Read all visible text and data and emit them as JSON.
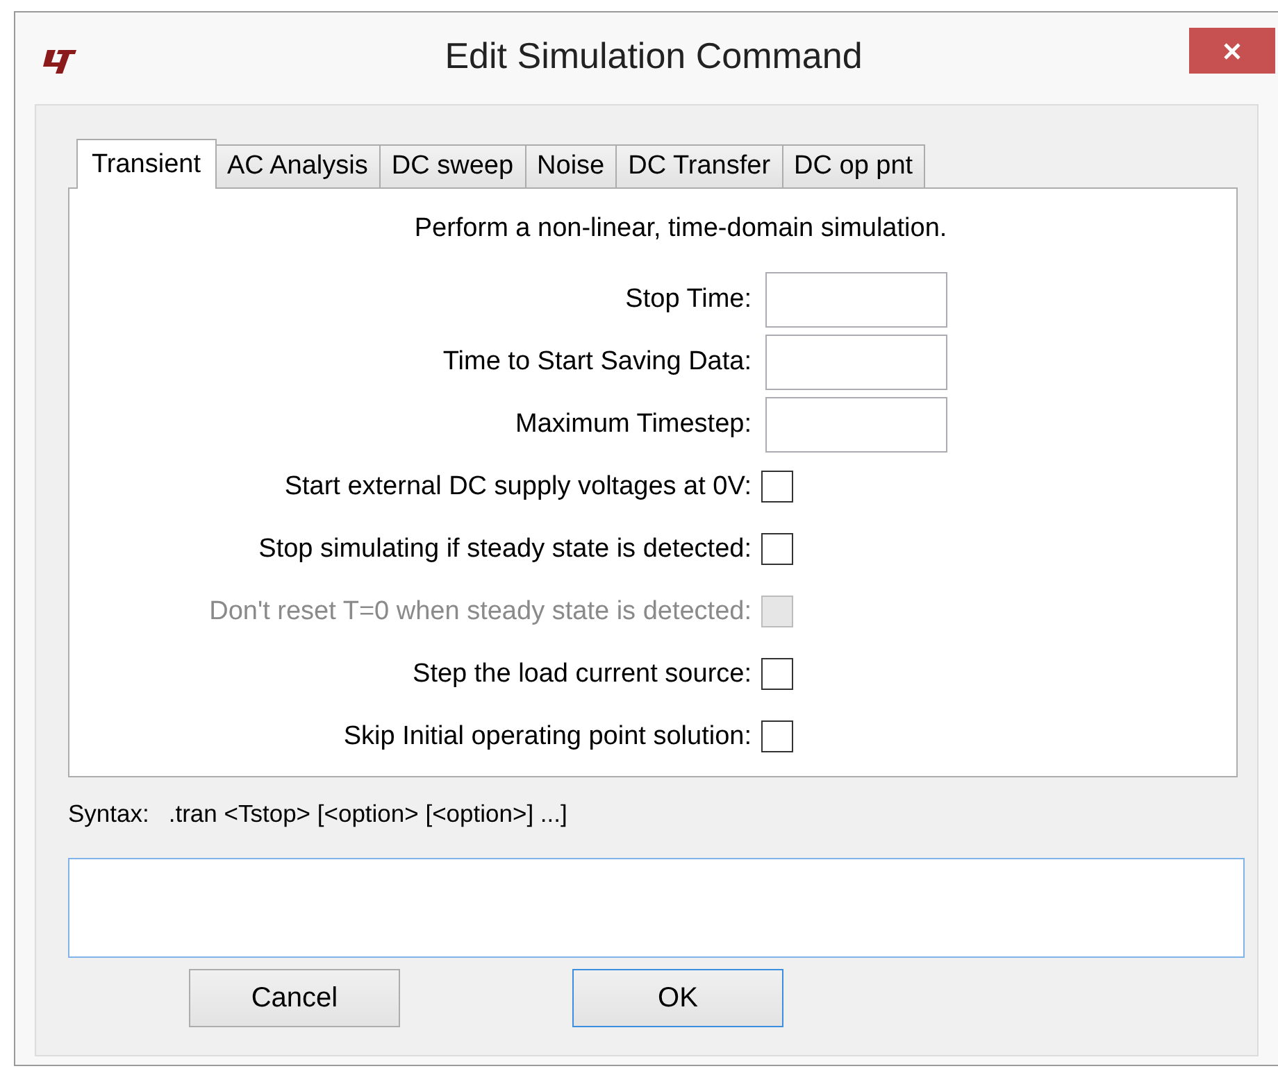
{
  "window": {
    "title": "Edit Simulation Command"
  },
  "tabs": [
    {
      "label": "Transient",
      "selected": true
    },
    {
      "label": "AC Analysis",
      "selected": false
    },
    {
      "label": "DC sweep",
      "selected": false
    },
    {
      "label": "Noise",
      "selected": false
    },
    {
      "label": "DC Transfer",
      "selected": false
    },
    {
      "label": "DC op pnt",
      "selected": false
    }
  ],
  "panel": {
    "description": "Perform a non-linear, time-domain simulation.",
    "fields": [
      {
        "kind": "text",
        "label": "Stop Time:"
      },
      {
        "kind": "text",
        "label": "Time to Start Saving Data:"
      },
      {
        "kind": "text",
        "label": "Maximum Timestep:"
      },
      {
        "kind": "checkbox",
        "label": "Start external DC supply voltages at 0V:",
        "checked": false,
        "disabled": false
      },
      {
        "kind": "checkbox",
        "label": "Stop simulating if steady state is detected:",
        "checked": false,
        "disabled": false
      },
      {
        "kind": "checkbox",
        "label": "Don't reset T=0 when steady state is detected:",
        "checked": false,
        "disabled": true
      },
      {
        "kind": "checkbox",
        "label": "Step the load current source:",
        "checked": false,
        "disabled": false
      },
      {
        "kind": "checkbox",
        "label": "Skip Initial operating point solution:",
        "checked": false,
        "disabled": false
      }
    ]
  },
  "syntax": {
    "label": "Syntax:",
    "value": ".tran <Tstop> [<option> [<option>] ...]"
  },
  "buttons": [
    {
      "label": "Cancel",
      "default": false
    },
    {
      "label": "OK",
      "default": true
    }
  ]
}
